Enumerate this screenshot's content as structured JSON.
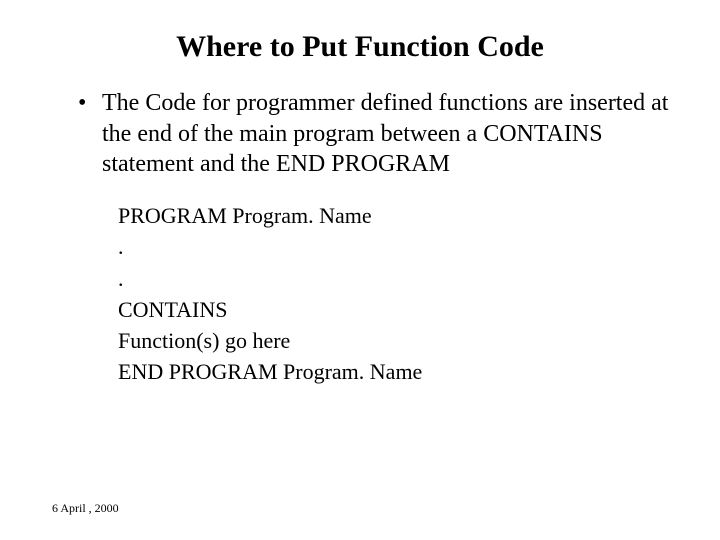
{
  "title": "Where to Put Function Code",
  "bullet": "The Code for programmer defined functions are inserted at the end of the main program between a CONTAINS statement and the END PROGRAM",
  "code": {
    "l1": "PROGRAM Program. Name",
    "l2": ".",
    "l3": ".",
    "l4": "CONTAINS",
    "l5": "Function(s) go here",
    "l6": "END PROGRAM Program. Name"
  },
  "footer": "6 April , 2000"
}
